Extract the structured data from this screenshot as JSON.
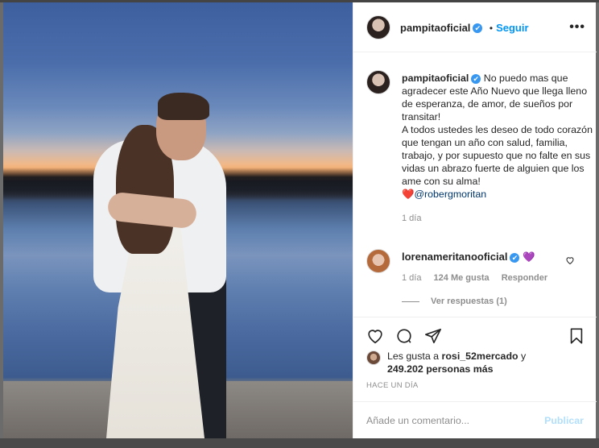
{
  "post": {
    "author": "pampitaoficial",
    "verified_badge": "✔",
    "separator": "•",
    "follow_label": "Seguir",
    "more_label": "•••",
    "caption_text": "No puedo mas que agradecer este Año Nuevo que llega lleno de esperanza, de amor, de sueños por transitar!",
    "caption_text_2": "A todos ustedes les deseo de todo corazón que tengan un año con salud, familia, trabajo, y por supuesto que no falte en sus vidas un abrazo fuerte de alguien que los ame con su alma!",
    "caption_heart": "❤️",
    "caption_mention": "@robergmoritan",
    "caption_time": "1 día"
  },
  "comment": {
    "author": "lorenameritanooficial",
    "verified_badge": "✔",
    "text": "💜",
    "time": "1 día",
    "likes": "124 Me gusta",
    "reply_label": "Responder",
    "view_replies": "Ver respuestas (1)"
  },
  "likes": {
    "prefix": "Les gusta a",
    "first_user": "rosi_52mercado",
    "and": "y",
    "count_text": "249.202 personas más"
  },
  "timestamp": "HACE UN DÍA",
  "composer": {
    "placeholder": "Añade un comentario...",
    "post_label": "Publicar"
  },
  "icons": {
    "like": "heart-outline-icon",
    "comment": "speech-bubble-icon",
    "share": "paper-plane-icon",
    "save": "bookmark-icon"
  },
  "colors": {
    "accent": "#0095f6",
    "verified": "#3897f0",
    "muted": "#8e8e8e",
    "publish_disabled": "#b2dffc"
  }
}
